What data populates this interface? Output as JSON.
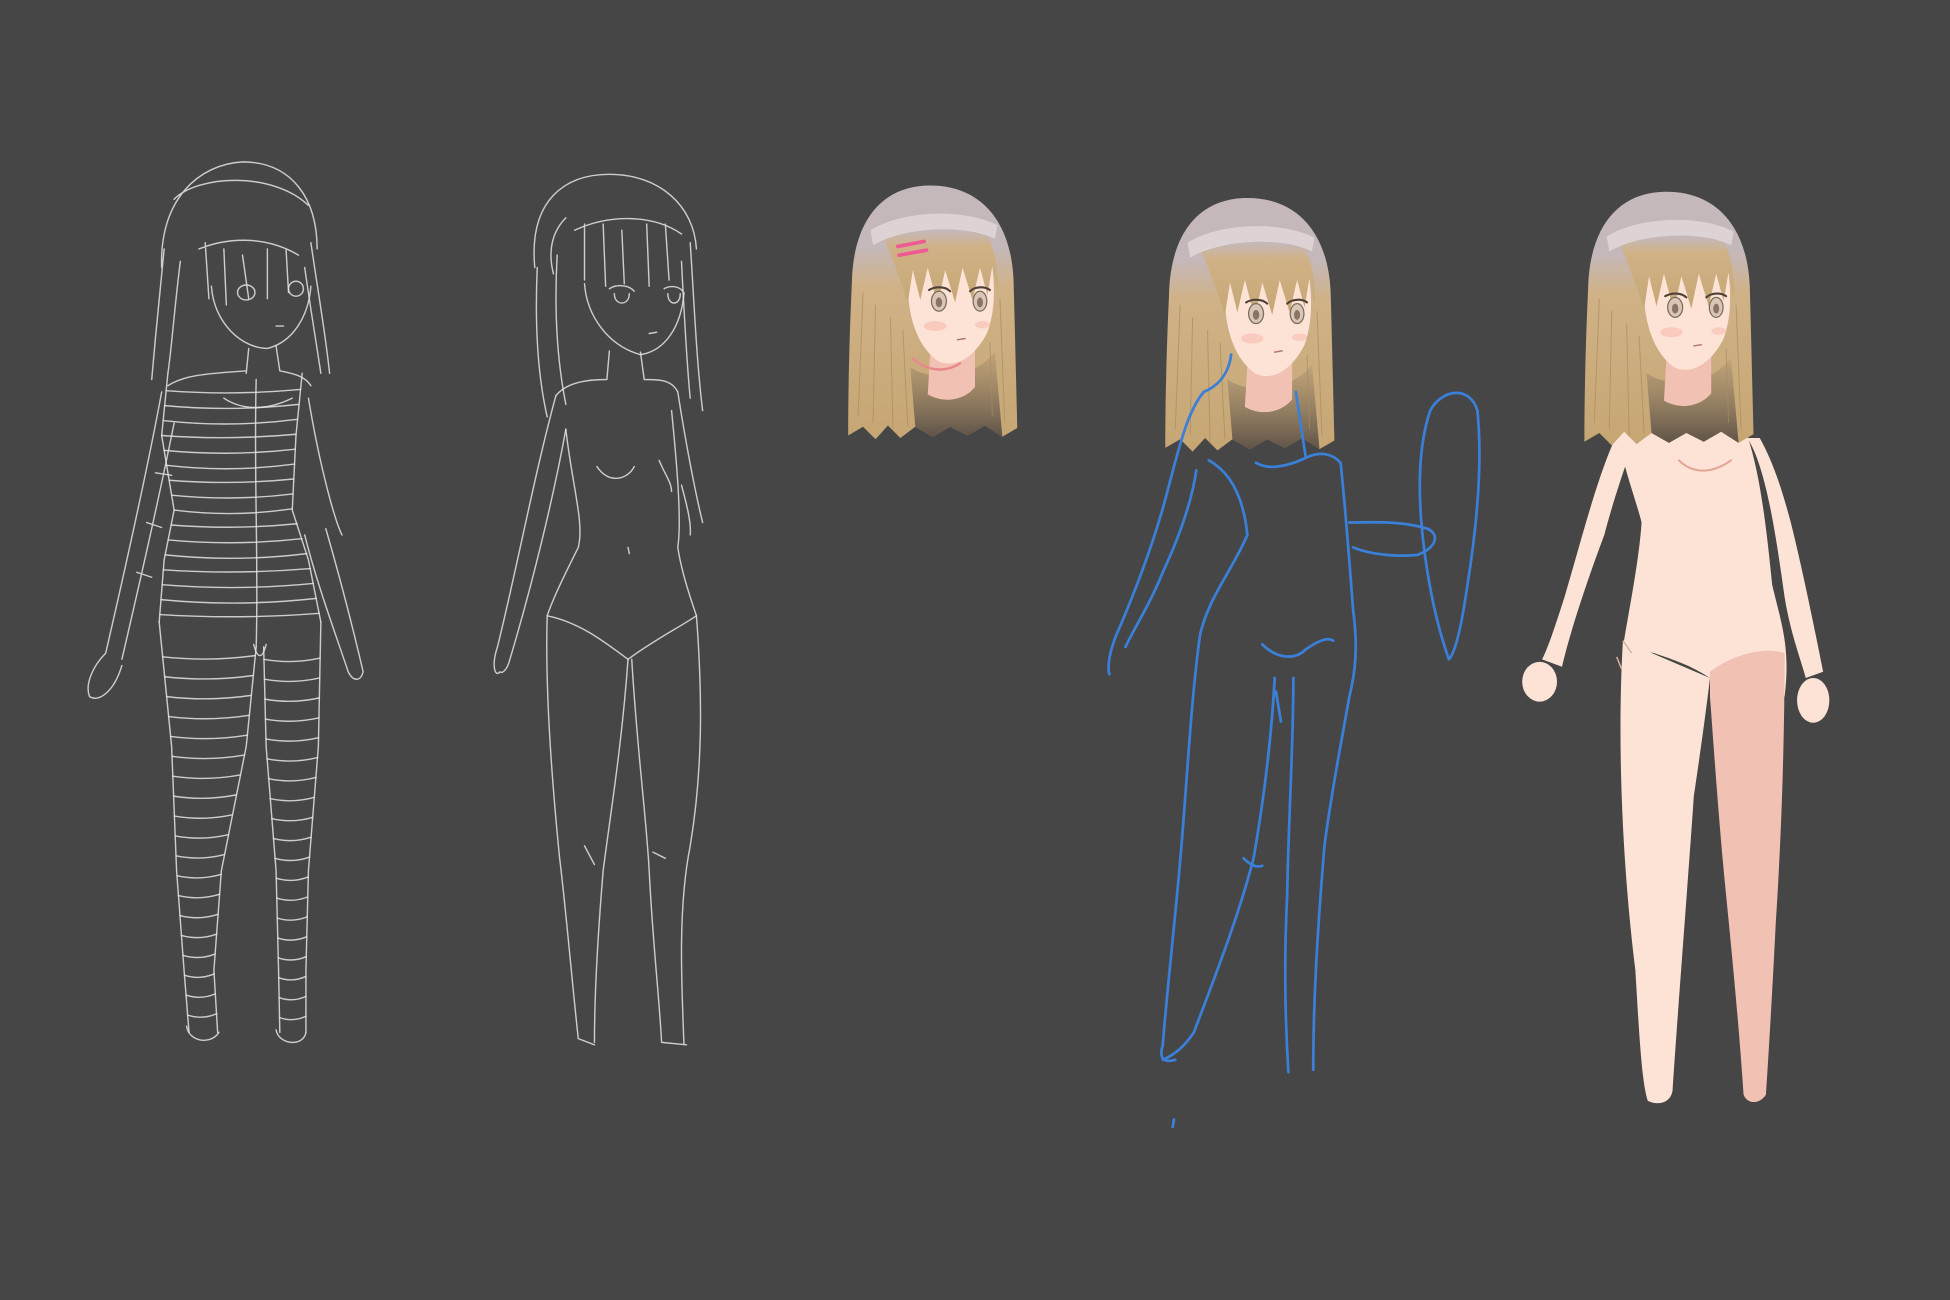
{
  "canvas": {
    "background_color": "#464646"
  },
  "palette": {
    "sketch_line": "#e4e4e4",
    "construction_line": "#3a7fd8",
    "hair_top": "#c4b8bb",
    "hair_base": "#d0b287",
    "hair_shadow": "#5f5348",
    "skin": "#fde3d6",
    "skin_shadow": "#f1c2b3",
    "hair_clip": "#ee5b93"
  }
}
